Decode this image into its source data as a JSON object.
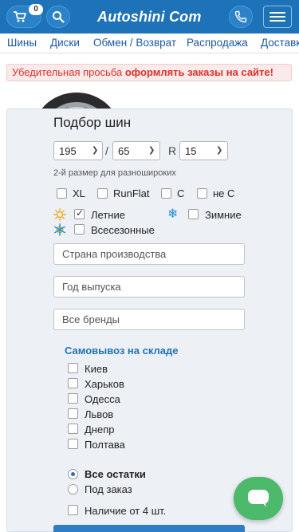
{
  "header": {
    "brand": "Autoshini Com",
    "cart_count": "0"
  },
  "nav": {
    "items": [
      "Шины",
      "Диски",
      "Обмен / Возврат",
      "Распродажа",
      "Доставк"
    ]
  },
  "notice": {
    "text_plain": "Убедительная просьба ",
    "text_bold": "оформлять заказы на сайте!"
  },
  "filter": {
    "title": "Подбор шин",
    "width_value": "195",
    "profile_value": "65",
    "radius_prefix": "R",
    "radius_value": "15",
    "separator": "/",
    "second_size_hint": "2-й размер для разноширoких",
    "options": {
      "xl": "XL",
      "runflat": "RunFlat",
      "c": "C",
      "not_c": "не С"
    },
    "seasons": {
      "summer": "Летние",
      "winter": "Зимние",
      "all_season": "Всесезонные",
      "summer_checked": true
    },
    "country_placeholder": "Страна производства",
    "year_placeholder": "Год выпуска",
    "brands_placeholder": "Все бренды",
    "pickup_title": "Самовывоз на складе",
    "cities": [
      "Киев",
      "Харьков",
      "Одесса",
      "Львов",
      "Днепр",
      "Полтава"
    ],
    "stock": {
      "all": "Все остатки",
      "order": "Под заказ",
      "min4": "Наличие от 4 шт."
    }
  },
  "colors": {
    "header_bg": "#1e73b8",
    "notice_text": "#d9322a",
    "panel_bg": "#edf1f6",
    "chat_bg": "#4cb96b",
    "snow": "#1e90d8",
    "sun": "#f2a81d"
  },
  "icons": {
    "cart": "cart-icon",
    "search": "search-icon",
    "phone": "phone-icon",
    "menu": "hamburger-icon",
    "summer": "sun-icon",
    "winter": "snowflake-icon",
    "all_season": "sun-snowflake-icon",
    "chat": "chat-bubble-icon"
  }
}
